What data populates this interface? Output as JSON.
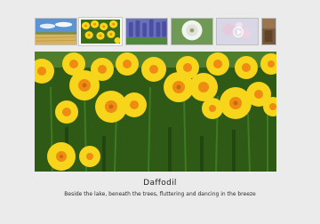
{
  "gallery": {
    "thumbnails": [
      {
        "subject": "wheat field under sky",
        "selected": false
      },
      {
        "subject": "yellow daffodils",
        "selected": true
      },
      {
        "subject": "purple grape hyacinths",
        "selected": false
      },
      {
        "subject": "dandelion seed head",
        "selected": false
      },
      {
        "subject": "video: pink flowers",
        "selected": false,
        "is_video": true
      },
      {
        "subject": "partial thumbnail",
        "selected": false
      }
    ],
    "current": {
      "title": "Daffodil",
      "description": "Beside the lake, beneath the trees, fluttering and dancing in the breeze"
    }
  },
  "colors": {
    "background": "#ebebeb",
    "thumb_border": "#bfbfbf",
    "selected_border": "#ffffff",
    "daffodil_petal": "#f6d51b",
    "daffodil_trumpet": "#ef8a12",
    "foliage": "#2e5a16"
  },
  "icons": {
    "video_thumbnail_overlay": "play-icon",
    "selection_pointer": "triangle-down-icon"
  }
}
